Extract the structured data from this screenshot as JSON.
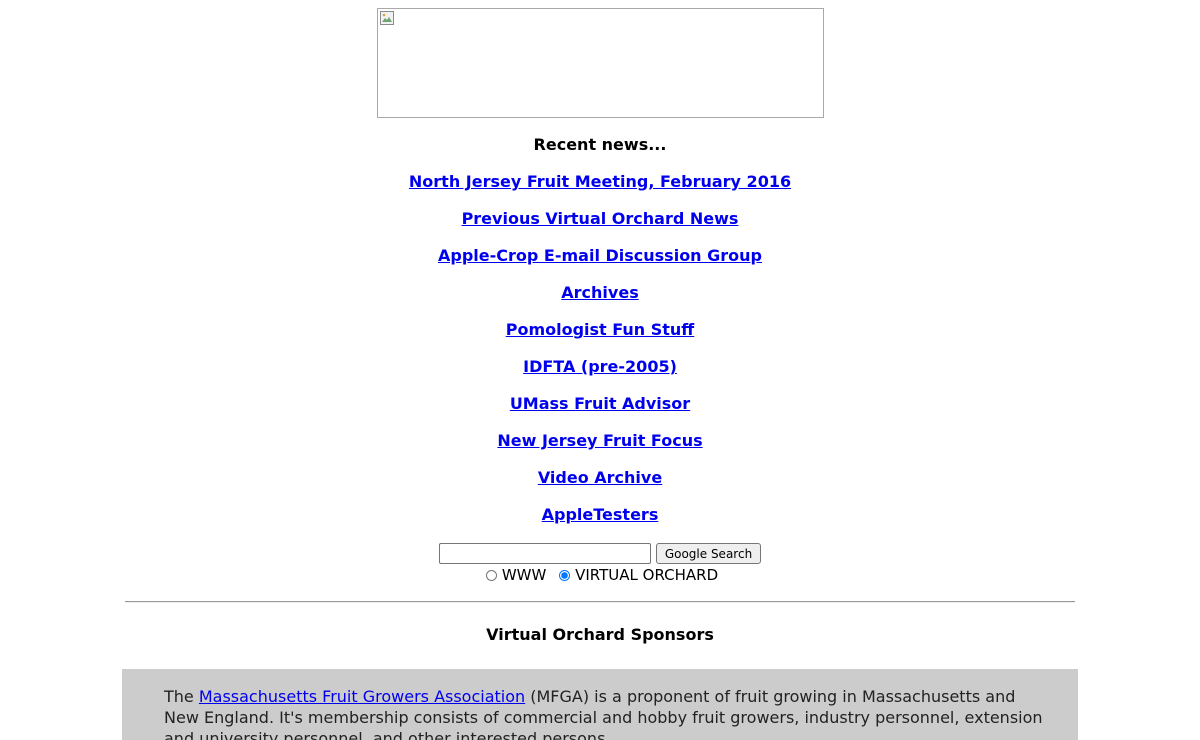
{
  "banner": {
    "icon": "broken-image-icon"
  },
  "news": {
    "heading": "Recent news...",
    "links": [
      "North Jersey Fruit Meeting, February 2016",
      "Previous Virtual Orchard News",
      "Apple-Crop E-mail Discussion Group",
      "Archives",
      "Pomologist Fun Stuff",
      "IDFTA (pre-2005)",
      "UMass Fruit Advisor",
      "New Jersey Fruit Focus",
      "Video Archive",
      "AppleTesters"
    ]
  },
  "search": {
    "value": "",
    "button_label": "Google Search",
    "options": [
      "WWW",
      "VIRTUAL ORCHARD"
    ],
    "selected": "VIRTUAL ORCHARD"
  },
  "sponsors": {
    "heading": "Virtual Orchard Sponsors",
    "text_before": "The ",
    "link_text": "Massachusetts Fruit Growers Association",
    "text_after": " (MFGA) is a proponent of fruit growing in Massachusetts and New England. It's membership consists of commercial and hobby fruit growers, industry personnel, extension and university personnel, and other interested persons."
  },
  "colors": {
    "link": "#0000ee",
    "sponsor_background": "#cccccc",
    "radio_accent": "#0075ff"
  }
}
